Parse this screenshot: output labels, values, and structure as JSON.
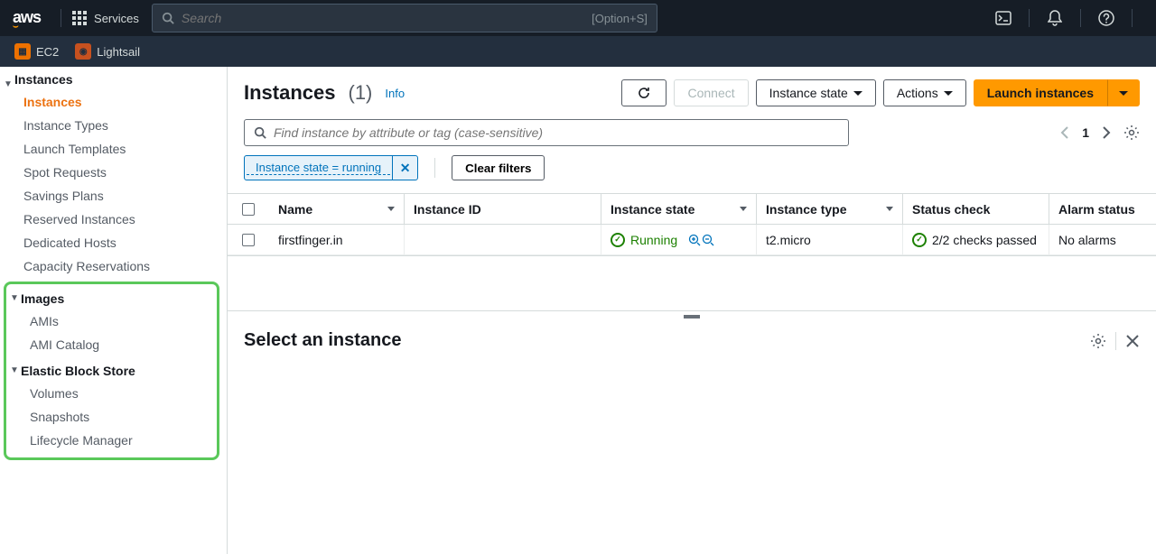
{
  "header": {
    "logo": "aws",
    "services_label": "Services",
    "search_placeholder": "Search",
    "search_hint": "[Option+S]"
  },
  "service_tabs": [
    {
      "name": "EC2",
      "badge": "ec2"
    },
    {
      "name": "Lightsail",
      "badge": "ls"
    }
  ],
  "sidebar": {
    "group_instances": "Instances",
    "items_instances": [
      "Instances",
      "Instance Types",
      "Launch Templates",
      "Spot Requests",
      "Savings Plans",
      "Reserved Instances",
      "Dedicated Hosts",
      "Capacity Reservations"
    ],
    "group_images": "Images",
    "items_images": [
      "AMIs",
      "AMI Catalog"
    ],
    "group_ebs": "Elastic Block Store",
    "items_ebs": [
      "Volumes",
      "Snapshots",
      "Lifecycle Manager"
    ]
  },
  "page": {
    "title": "Instances",
    "count": "(1)",
    "info": "Info",
    "connect": "Connect",
    "instance_state": "Instance state",
    "actions": "Actions",
    "launch": "Launch instances",
    "search_placeholder": "Find instance by attribute or tag (case-sensitive)",
    "page_number": "1",
    "filter_tag": "Instance state = running",
    "clear_filters": "Clear filters"
  },
  "table": {
    "columns": {
      "name": "Name",
      "id": "Instance ID",
      "state": "Instance state",
      "type": "Instance type",
      "status": "Status check",
      "alarm": "Alarm status"
    },
    "row": {
      "name": "firstfinger.in",
      "state": "Running",
      "type": "t2.micro",
      "status": "2/2 checks passed",
      "alarm": "No alarms"
    }
  },
  "bottom": {
    "title": "Select an instance"
  }
}
